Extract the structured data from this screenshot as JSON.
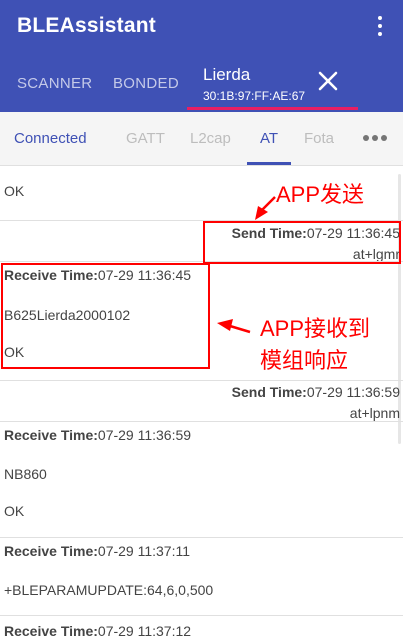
{
  "appbar": {
    "title": "BLEAssistant",
    "tabs": {
      "scanner": "SCANNER",
      "bonded": "BONDED"
    },
    "device_tab": {
      "name": "Lierda",
      "mac": "30:1B:97:FF:AE:67"
    }
  },
  "subtabs": {
    "connected": "Connected",
    "gatt": "GATT",
    "l2cap": "L2cap",
    "at": "AT",
    "fota": "Fota"
  },
  "log": {
    "ok_top": "OK",
    "send1": {
      "label": "Send Time:",
      "time": "07-29 11:36:45",
      "cmd": "at+lgmr"
    },
    "recv1": {
      "label": "Receive Time:",
      "time": "07-29 11:36:45",
      "line1": "B625Lierda2000102",
      "line2": "OK"
    },
    "send2": {
      "label": "Send Time:",
      "time": "07-29 11:36:59",
      "cmd": "at+lpnm"
    },
    "recv2": {
      "label": "Receive Time:",
      "time": "07-29 11:36:59",
      "line1": "NB860",
      "line2": "OK"
    },
    "recv3": {
      "label": "Receive Time:",
      "time": "07-29 11:37:11",
      "line1": "+BLEPARAMUPDATE:64,6,0,500"
    },
    "recv4": {
      "label": "Receive Time:",
      "time": "07-29 11:37:12"
    }
  },
  "annotations": {
    "app_send": "APP发送",
    "app_recv_line1": "APP接收到",
    "app_recv_line2": "模组响应",
    "color": "#ff0000"
  },
  "colors": {
    "primary": "#3f51b5",
    "accent": "#e91e63"
  }
}
